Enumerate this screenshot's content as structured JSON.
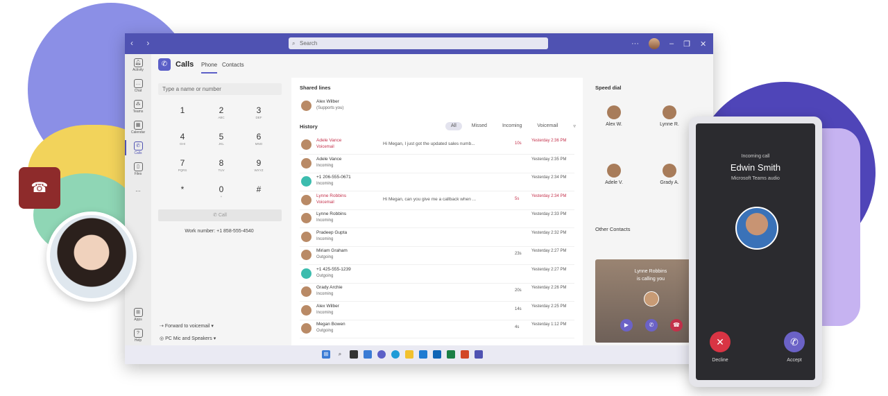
{
  "search": {
    "placeholder": "Search"
  },
  "rail": [
    {
      "label": "Activity"
    },
    {
      "label": "Chat"
    },
    {
      "label": "Teams"
    },
    {
      "label": "Calendar"
    },
    {
      "label": "Calls"
    },
    {
      "label": "Files"
    },
    {
      "label": "..."
    },
    {
      "label": "Apps"
    },
    {
      "label": "Help"
    }
  ],
  "header": {
    "title": "Calls",
    "tabs": [
      "Phone",
      "Contacts"
    ]
  },
  "dialpad": {
    "placeholder": "Type a name or number",
    "keys": [
      {
        "digit": "1",
        "letters": ""
      },
      {
        "digit": "2",
        "letters": "ABC"
      },
      {
        "digit": "3",
        "letters": "DEF"
      },
      {
        "digit": "4",
        "letters": "GHI"
      },
      {
        "digit": "5",
        "letters": "JKL"
      },
      {
        "digit": "6",
        "letters": "MNO"
      },
      {
        "digit": "7",
        "letters": "PQRS"
      },
      {
        "digit": "8",
        "letters": "TUV"
      },
      {
        "digit": "9",
        "letters": "WXYZ"
      },
      {
        "digit": "*",
        "letters": ""
      },
      {
        "digit": "0",
        "letters": "+"
      },
      {
        "digit": "#",
        "letters": ""
      }
    ],
    "call_label": "Call",
    "work_number": "Work number: +1 858-555-4540",
    "forward": "Forward to voicemail",
    "device": "PC Mic and Speakers"
  },
  "shared_lines": {
    "title": "Shared lines",
    "name": "Alex Wilber",
    "sub": "(Supports you)"
  },
  "history": {
    "title": "History",
    "filters": [
      "All",
      "Missed",
      "Incoming",
      "Voicemail"
    ],
    "rows": [
      {
        "name": "Adele Vance",
        "type": "Voicemail",
        "msg": "Hi Megan, I just got the updated sales numb...",
        "dur": "10s",
        "time": "Yesterday 2:36 PM",
        "missed": true
      },
      {
        "name": "Adele Vance",
        "type": "Incoming",
        "msg": "",
        "dur": "",
        "time": "Yesterday 2:35 PM",
        "missed": false
      },
      {
        "name": "+1 206-555-0671",
        "type": "Incoming",
        "msg": "",
        "dur": "",
        "time": "Yesterday 2:34 PM",
        "missed": false
      },
      {
        "name": "Lynne Robbins",
        "type": "Voicemail",
        "msg": "Hi Megan, can you give me a callback when ...",
        "dur": "5s",
        "time": "Yesterday 2:34 PM",
        "missed": true
      },
      {
        "name": "Lynne Robbins",
        "type": "Incoming",
        "msg": "",
        "dur": "",
        "time": "Yesterday 2:33 PM",
        "missed": false
      },
      {
        "name": "Pradeep Gupta",
        "type": "Incoming",
        "msg": "",
        "dur": "",
        "time": "Yesterday 2:32 PM",
        "missed": false
      },
      {
        "name": "Miriam Graham",
        "type": "Outgoing",
        "msg": "",
        "dur": "23s",
        "time": "Yesterday 2:27 PM",
        "missed": false
      },
      {
        "name": "+1 425-555-1239",
        "type": "Outgoing",
        "msg": "",
        "dur": "",
        "time": "Yesterday 2:27 PM",
        "missed": false
      },
      {
        "name": "Grady Archie",
        "type": "Incoming",
        "msg": "",
        "dur": "20s",
        "time": "Yesterday 2:26 PM",
        "missed": false
      },
      {
        "name": "Alex Wilber",
        "type": "Incoming",
        "msg": "",
        "dur": "14s",
        "time": "Yesterday 2:25 PM",
        "missed": false
      },
      {
        "name": "Megan Bowen",
        "type": "Outgoing",
        "msg": "",
        "dur": "4s",
        "time": "Yesterday 1:12 PM",
        "missed": false
      }
    ]
  },
  "speed_dial": {
    "title": "Speed dial",
    "contacts": [
      "Alex W.",
      "Lynne R.",
      "Adele V.",
      "Grady A."
    ]
  },
  "other_contacts": {
    "title": "Other Contacts"
  },
  "notification": {
    "line1": "Lynne Robbins",
    "line2": "is calling you"
  },
  "phone": {
    "status": "Incoming call",
    "caller": "Edwin Smith",
    "sub": "Microsoft Teams audio",
    "decline": "Decline",
    "accept": "Accept"
  },
  "colors": {
    "accent": "#4f52b2",
    "decline": "#c4314b",
    "hangup": "#8e2b2b"
  }
}
